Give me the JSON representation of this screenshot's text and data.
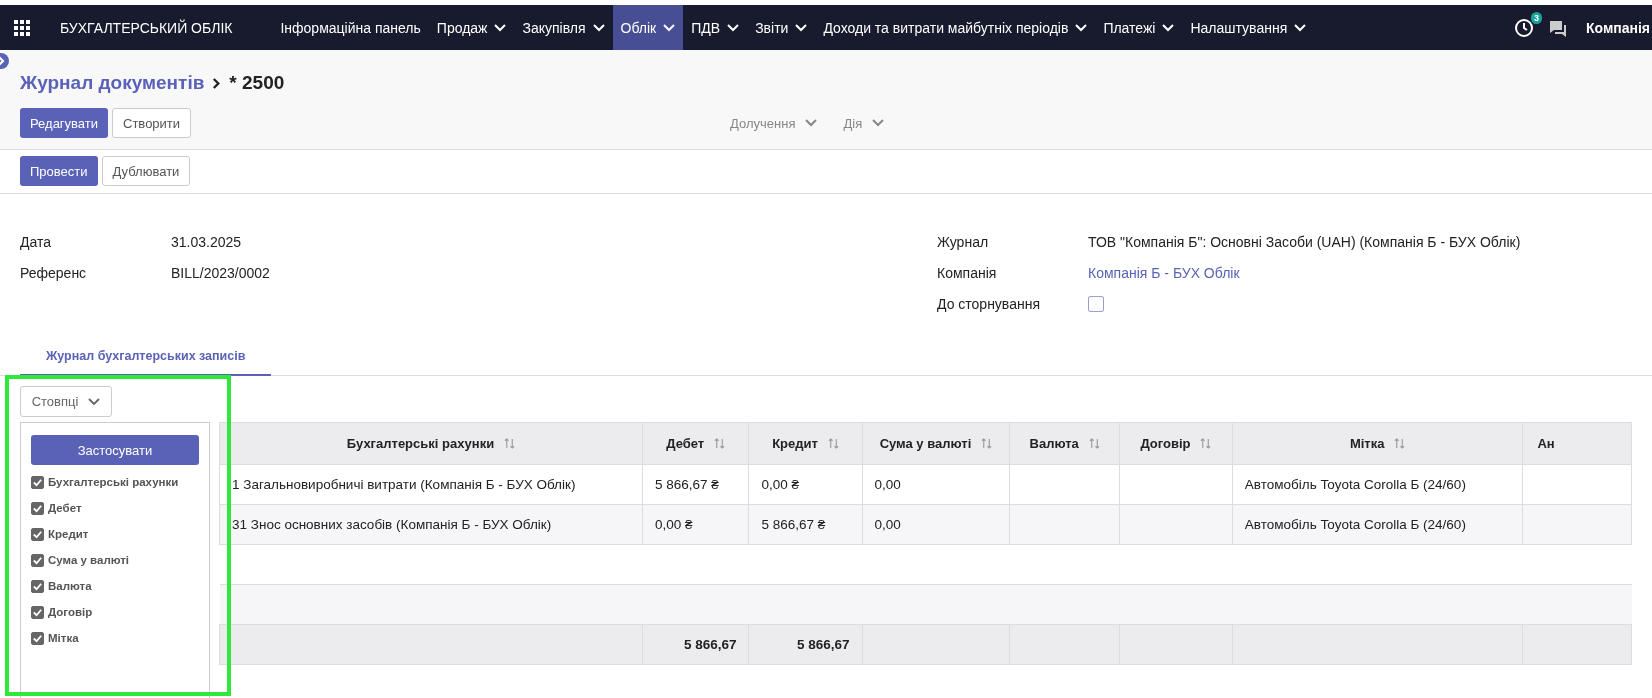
{
  "navbar": {
    "app_title": "БУХГАЛТЕРСЬКИЙ ОБЛІК",
    "menu": [
      {
        "label": "Інформаційна панель",
        "dropdown": false,
        "selected": false
      },
      {
        "label": "Продаж",
        "dropdown": true,
        "selected": false
      },
      {
        "label": "Закупівля",
        "dropdown": true,
        "selected": false
      },
      {
        "label": "Облік",
        "dropdown": true,
        "selected": true
      },
      {
        "label": "ПДВ",
        "dropdown": true,
        "selected": false
      },
      {
        "label": "Звіти",
        "dropdown": true,
        "selected": false
      },
      {
        "label": "Доходи та витрати майбутніх періодів",
        "dropdown": true,
        "selected": false
      },
      {
        "label": "Платежі",
        "dropdown": true,
        "selected": false
      },
      {
        "label": "Налаштування",
        "dropdown": true,
        "selected": false
      }
    ],
    "activity_count": "3",
    "company": "Компанія"
  },
  "breadcrumb": {
    "parent": "Журнал документів",
    "current": "* 2500"
  },
  "toolbar": {
    "buttons": [
      {
        "label": "Редагувати",
        "kind": "primary"
      },
      {
        "label": "Створити",
        "kind": "secondary"
      }
    ],
    "menus": [
      "Долучення",
      "Дія"
    ]
  },
  "status_buttons": [
    {
      "label": "Провести",
      "kind": "primary"
    },
    {
      "label": "Дублювати",
      "kind": "secondary"
    }
  ],
  "fields_left": [
    {
      "label": "Дата",
      "value": "31.03.2025",
      "kind": "text"
    },
    {
      "label": "Референс",
      "value": "BILL/2023/0002",
      "kind": "text"
    }
  ],
  "fields_right": [
    {
      "label": "Журнал",
      "value": "ТОВ \"Компанія Б\": Основні Засоби (UAH) (Компанія Б - БУХ Облік)",
      "kind": "text"
    },
    {
      "label": "Компанія",
      "value": "Компанія Б - БУХ Облік",
      "kind": "link"
    },
    {
      "label": "До сторнування",
      "checked": false,
      "kind": "checkbox"
    }
  ],
  "tabs": [
    {
      "label": "Журнал бухгалтерських записів",
      "selected": true
    }
  ],
  "columns_button": "Стовпці",
  "columns_menu": {
    "apply": "Застосувати",
    "options": [
      {
        "label": "Бухгалтерські рахунки",
        "checked": true
      },
      {
        "label": "Дебет",
        "checked": true
      },
      {
        "label": "Кредит",
        "checked": true
      },
      {
        "label": "Сума у валюті",
        "checked": true
      },
      {
        "label": "Валюта",
        "checked": true
      },
      {
        "label": "Договір",
        "checked": true
      },
      {
        "label": "Мітка",
        "checked": true
      }
    ]
  },
  "table": {
    "columns": [
      {
        "label": "Бухгалтерські рахунки",
        "sortable": true
      },
      {
        "label": "Дебет",
        "sortable": true
      },
      {
        "label": "Кредит",
        "sortable": true
      },
      {
        "label": "Сума у валюті",
        "sortable": true
      },
      {
        "label": "Валюта",
        "sortable": true
      },
      {
        "label": "Договір",
        "sortable": true
      },
      {
        "label": "Мітка",
        "sortable": true
      },
      {
        "label": "Ан",
        "sortable": false
      }
    ],
    "rows": [
      [
        "1 Загальновиробничі витрати (Компанія Б - БУХ Облік)",
        "5 866,67 ₴",
        "0,00 ₴",
        "0,00",
        null,
        null,
        "Автомобіль Toyota Corolla Б (24/60)",
        null
      ],
      [
        "31 Знос основних засобів (Компанія Б - БУХ Облік)",
        "0,00 ₴",
        "5 866,67 ₴",
        "0,00",
        null,
        null,
        "Автомобіль Toyota Corolla Б (24/60)",
        null
      ]
    ],
    "totals": {
      "debit": "5 866,67",
      "credit": "5 866,67"
    }
  }
}
